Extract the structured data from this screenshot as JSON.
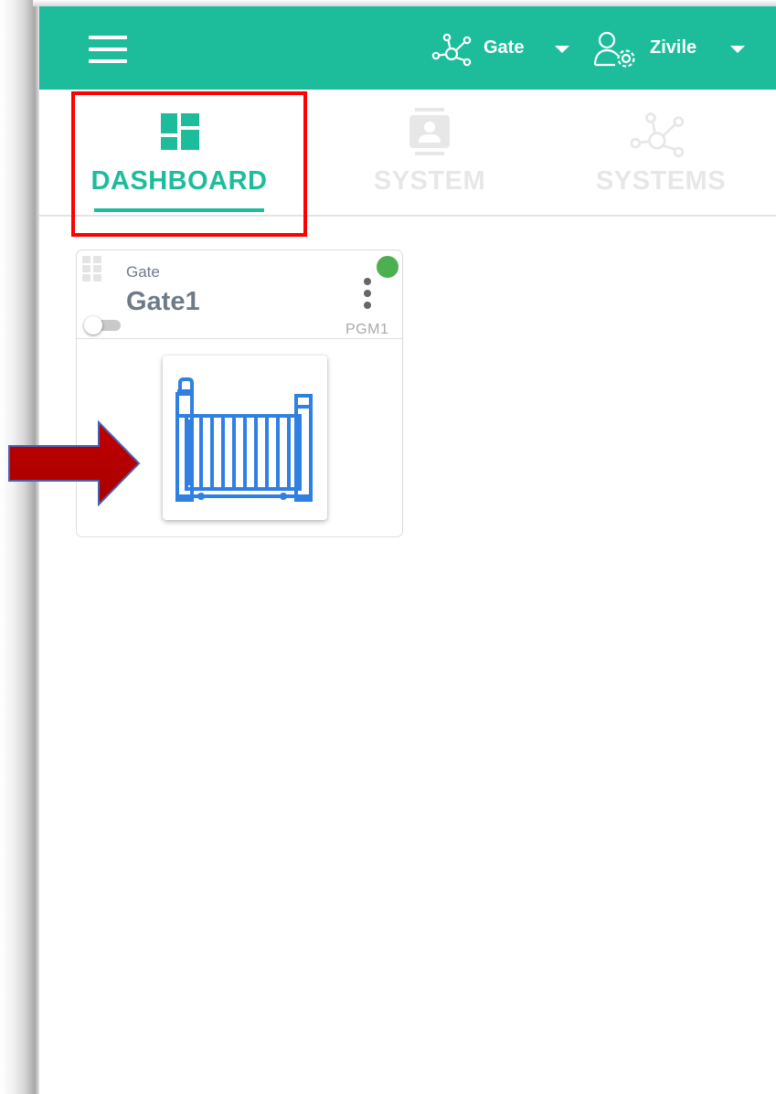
{
  "header": {
    "menu_icon": "hamburger-menu-icon",
    "system_selector": {
      "icon": "network-nodes-icon",
      "label": "Gate"
    },
    "user_selector": {
      "icon": "user-settings-icon",
      "label": "Zivile"
    },
    "caret_icon": "caret-down-icon",
    "color": "#1dbd9c"
  },
  "tabs": [
    {
      "label": "DASHBOARD",
      "icon": "dashboard-grid-icon",
      "active": true
    },
    {
      "label": "SYSTEM",
      "icon": "contact-card-icon",
      "active": false
    },
    {
      "label": "SYSTEMS",
      "icon": "network-nodes-icon",
      "active": false
    }
  ],
  "card": {
    "type_label": "Gate",
    "name": "Gate1",
    "output_label": "PGM1",
    "status_color": "#4caf50",
    "toggle_on": false,
    "control_icon": "sliding-gate-icon",
    "control_icon_color": "#2f80e2"
  },
  "annotations": {
    "highlight_box_color": "#ff0000",
    "arrow_color": "#c00000"
  }
}
